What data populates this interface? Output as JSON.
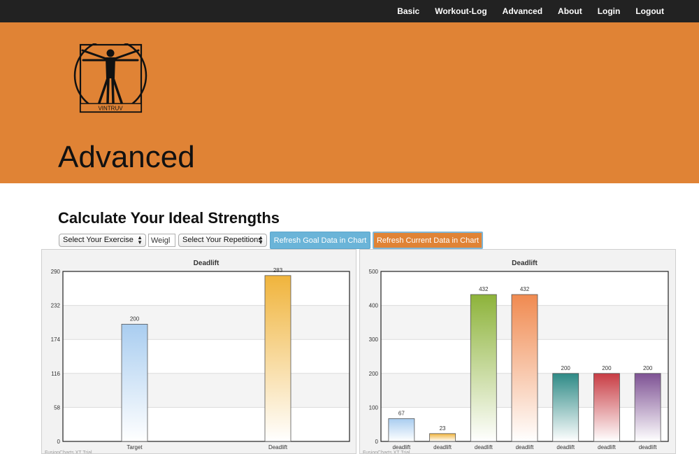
{
  "nav": {
    "items": [
      "Basic",
      "Workout-Log",
      "Advanced",
      "About",
      "Login",
      "Logout"
    ]
  },
  "logo": {
    "text": "VINTRUV"
  },
  "hero": {
    "title": "Advanced"
  },
  "section": {
    "title": "Calculate Your Ideal Strengths"
  },
  "controls": {
    "exercise_select": "Select Your Exercise",
    "weight_input_value": "Weigl",
    "reps_select": "Select Your Repetitions",
    "refresh_goal_label": "Refresh Goal Data in Chart",
    "refresh_current_label": "Refresh Current Data in Chart"
  },
  "colors": {
    "navbar": "#222222",
    "hero": "#e08335",
    "goal_button": "#6ab4d8",
    "current_button": "#e08335"
  },
  "chart_data": [
    {
      "type": "bar",
      "title": "Deadlift",
      "categories": [
        "Target",
        "Deadlift"
      ],
      "values": [
        200,
        283
      ],
      "colors": [
        "#a9cdf0",
        "#f0b43c"
      ],
      "ylim": [
        0,
        290
      ],
      "yticks": [
        0,
        58,
        116,
        174,
        232,
        290
      ],
      "grid": true,
      "watermark": "FusionCharts XT Trial"
    },
    {
      "type": "bar",
      "title": "Deadlift",
      "categories": [
        "deadlift",
        "deadlift",
        "deadlift",
        "deadlift",
        "deadlift",
        "deadlift",
        "deadlift"
      ],
      "values": [
        67,
        23,
        432,
        432,
        200,
        200,
        200
      ],
      "colors": [
        "#a9cdf0",
        "#f0b43c",
        "#8db33a",
        "#f08a50",
        "#2e8a86",
        "#c83c44",
        "#7e5294"
      ],
      "ylim": [
        0,
        500
      ],
      "yticks": [
        0,
        100,
        200,
        300,
        400,
        500
      ],
      "grid": true,
      "watermark": "FusionCharts XT Trial"
    }
  ]
}
